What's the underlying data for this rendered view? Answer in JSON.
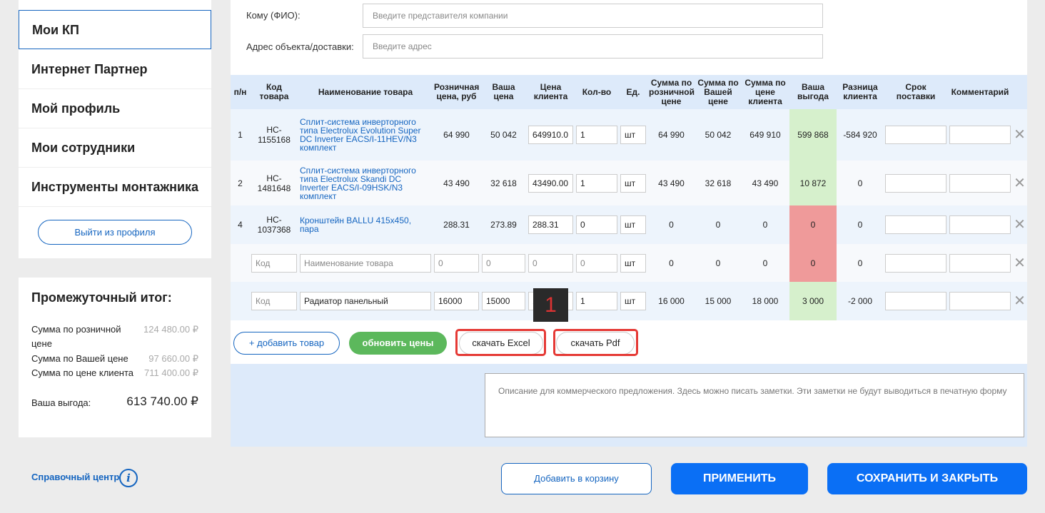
{
  "sidebar": {
    "items": [
      {
        "label": "Мои КП"
      },
      {
        "label": "Интернет Партнер"
      },
      {
        "label": "Мой профиль"
      },
      {
        "label": "Мои сотрудники"
      },
      {
        "label": "Инструменты монтажника"
      }
    ],
    "logout_label": "Выйти из профиля"
  },
  "subtotal": {
    "title": "Промежуточный итог:",
    "rows": [
      {
        "label": "Сумма по розничной цене",
        "value": "124 480.00 ₽"
      },
      {
        "label": "Сумма по Вашей цене",
        "value": "97 660.00 ₽"
      },
      {
        "label": "Сумма по цене клиента",
        "value": "711 400.00 ₽"
      }
    ],
    "benefit_label": "Ваша выгода:",
    "benefit_value": "613 740.00 ₽"
  },
  "help": {
    "label": "Справочный центр",
    "icon": "info-icon"
  },
  "form": {
    "to_label": "Кому (ФИО):",
    "to_placeholder": "Введите представителя компании",
    "address_label": "Адрес объекта/доставки:",
    "address_placeholder": "Введите адрес"
  },
  "table": {
    "headers": [
      "п/н",
      "Код товара",
      "Наименование товара",
      "Розничная цена, руб",
      "Ваша цена",
      "Цена клиента",
      "Кол-во",
      "Ед.",
      "Сумма по розничной цене",
      "Сумма по Вашей цене",
      "Сумма по цене клиента",
      "Ваша выгода",
      "Разница клиента",
      "Срок поставки",
      "Комментарий"
    ],
    "rows": [
      {
        "num": "1",
        "code": "HC-1155168",
        "name": "Сплит-система инверторного типа Electrolux Evolution Super DC Inverter EACS/I-11HEV/N3 комплект",
        "retail": "64 990",
        "your": "50 042",
        "client": "649910.0",
        "qty": "1",
        "unit": "шт",
        "sum_retail": "64 990",
        "sum_your": "50 042",
        "sum_client": "649 910",
        "benefit": "599 868",
        "diff": "-584 920"
      },
      {
        "num": "2",
        "code": "HC-1481648",
        "name": "Сплит-система инверторного типа Electrolux Skandi DC Inverter EACS/I-09HSK/N3 комплект",
        "retail": "43 490",
        "your": "32 618",
        "client": "43490.00",
        "qty": "1",
        "unit": "шт",
        "sum_retail": "43 490",
        "sum_your": "32 618",
        "sum_client": "43 490",
        "benefit": "10 872",
        "diff": "0"
      },
      {
        "num": "4",
        "code": "HC-1037368",
        "name": "Кронштейн BALLU 415x450, пара",
        "retail": "288.31",
        "your": "273.89",
        "client": "288.31",
        "qty": "0",
        "unit": "шт",
        "sum_retail": "0",
        "sum_your": "0",
        "sum_client": "0",
        "benefit": "0",
        "diff": "0"
      },
      {
        "num": "",
        "code_placeholder": "Код",
        "name_placeholder": "Наименование товара",
        "retail": "0",
        "your": "0",
        "client": "0",
        "qty": "0",
        "unit": "шт",
        "sum_retail": "0",
        "sum_your": "0",
        "sum_client": "0",
        "benefit": "0",
        "diff": "0"
      },
      {
        "num": "",
        "code_placeholder": "Код",
        "name": "Радиатор панельный",
        "retail": "16000",
        "your": "15000",
        "client": "18000",
        "qty": "1",
        "unit": "шт",
        "sum_retail": "16 000",
        "sum_your": "15 000",
        "sum_client": "18 000",
        "benefit": "3 000",
        "diff": "-2 000"
      }
    ]
  },
  "actions": {
    "add_label": "+ добавить товар",
    "refresh_label": "обновить цены",
    "excel_label": "скачать Excel",
    "pdf_label": "скачать Pdf"
  },
  "description": {
    "placeholder": "Описание для коммерческого предложения. Здесь можно писать заметки. Эти заметки не будут выводиться в печатную форму"
  },
  "marker": {
    "label": "1"
  },
  "bottom": {
    "cart_label": "Добавить в корзину",
    "apply_label": "ПРИМЕНИТЬ",
    "save_label": "СОХРАНИТЬ И ЗАКРЫТЬ"
  },
  "colors": {
    "accent": "#1565c0",
    "primary_button": "#0a6ff5",
    "green": "#5cb85c",
    "benefit_positive": "#d6f0cc",
    "benefit_zero": "#ef9a9a",
    "highlight": "#e53935"
  }
}
